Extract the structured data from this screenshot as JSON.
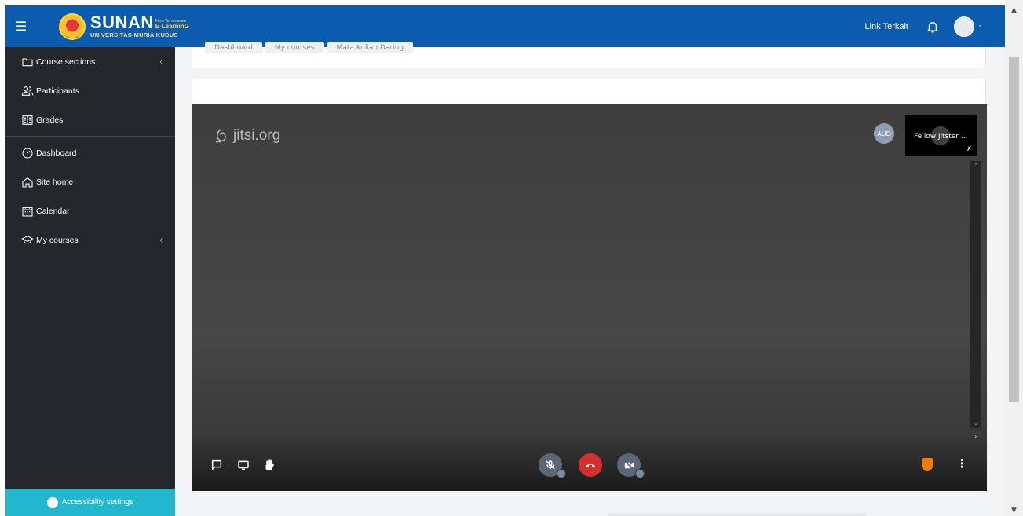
{
  "brand": {
    "logo_main": "SUNAN",
    "logo_tagline": "Ilmu Terrenaran",
    "logo_elearning": "E-LearninG",
    "logo_university": "UNIVERSITAS MURIA KUDUS"
  },
  "header": {
    "link_terkait": "Link Terkait",
    "icons": [
      "hamburger-icon",
      "bell-icon",
      "avatar"
    ]
  },
  "sidebar": {
    "items": [
      {
        "label": "Course sections",
        "icon": "folder-icon",
        "has_caret": true
      },
      {
        "label": "Participants",
        "icon": "users-icon"
      },
      {
        "label": "Grades",
        "icon": "gradebook-icon"
      },
      {
        "label": "Dashboard",
        "icon": "gauge-icon"
      },
      {
        "label": "Site home",
        "icon": "home-icon"
      },
      {
        "label": "Calendar",
        "icon": "calendar-icon"
      },
      {
        "label": "My courses",
        "icon": "graduation-cap-icon",
        "has_caret": true
      }
    ],
    "accessibility_label": "Accessibility settings"
  },
  "breadcrumb": [
    "Dashboard",
    "My courses",
    "Mata Kuliah Daring"
  ],
  "meeting": {
    "watermark": "jitsi.org",
    "aud_label": "AUD",
    "participant_name": "Fellow Jitster ..."
  },
  "colors": {
    "navbar": "#0b5cae",
    "sidebar": "#24272b",
    "accessibility": "#20b7cf",
    "hangup": "#d32f2f"
  }
}
